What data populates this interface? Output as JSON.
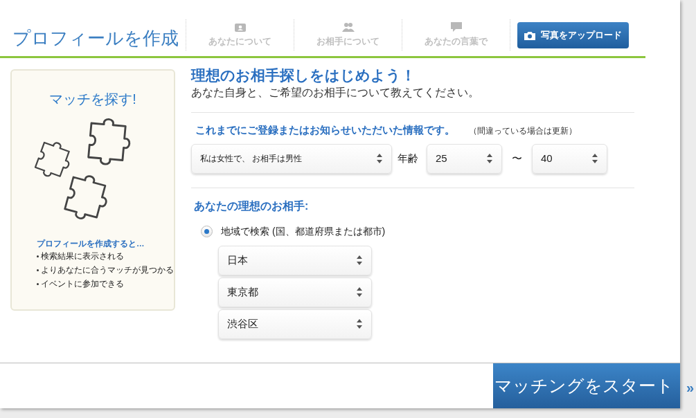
{
  "header": {
    "title": "プロフィールを作成",
    "steps": [
      {
        "label": "あなたについて",
        "kind": "profile",
        "selected": false
      },
      {
        "label": "お相手について",
        "kind": "people",
        "selected": false
      },
      {
        "label": "あなたの言葉で",
        "kind": "chat",
        "selected": false
      }
    ],
    "upload_button": "写真をアップロード"
  },
  "sidebar": {
    "title": "マッチを探す!",
    "benefits_title": "プロフィールを作成すると…",
    "benefits": [
      "検索結果に表示される",
      "よりあなたに合うマッチが見つかる",
      "イベントに参加できる"
    ]
  },
  "main": {
    "heading": "理想のお相手探しをはじめよう！",
    "subheading": "あなた自身と、ご希望のお相手について教えてください。",
    "info_title": "これまでにご登録またはお知らせいただいた情報です。",
    "info_note": "（間違っている場合は更新）",
    "gender_select": "私は女性で、 お相手は男性",
    "age_label": "年齢",
    "age_min": "25",
    "age_separator": "〜",
    "age_max": "40",
    "ideal_title": "あなたの理想のお相手:",
    "search_options": [
      {
        "label": "地域で検索 (国、都道府県または都市)",
        "selected": true
      }
    ],
    "location_selects": [
      "日本",
      "東京都",
      "渋谷区"
    ]
  },
  "footer": {
    "start_button": "マッチングをスタート",
    "arrow": "»"
  }
}
